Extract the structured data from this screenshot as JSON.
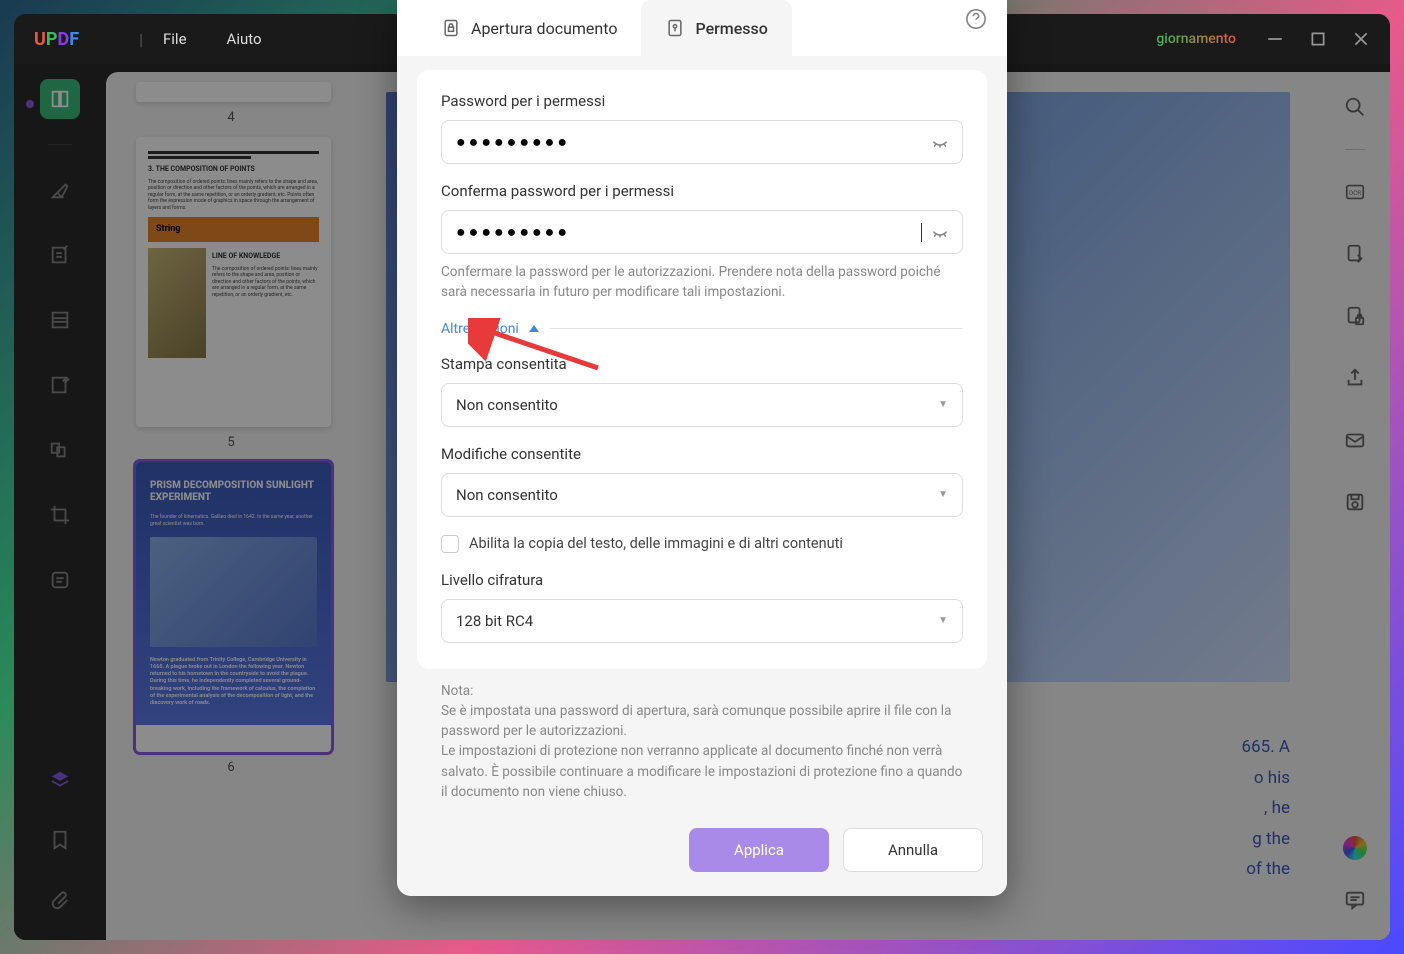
{
  "titlebar": {
    "logo_chars": [
      "U",
      "P",
      "D",
      "F"
    ],
    "menu_file": "File",
    "menu_help": "Aiuto",
    "update_text": "giornamento"
  },
  "thumbnails": {
    "page4_num": "4",
    "page5_num": "5",
    "page6_num": "6",
    "page5": {
      "heading": "3. THE COMPOSITION OF POINTS",
      "band": "String",
      "sub": "LINE OF KNOWLEDGE"
    },
    "page6": {
      "title": "PRISM DECOMPOSITION SUNLIGHT EXPERIMENT",
      "caption": "Newton graduated from Trinity College, Cambridge University in 1665. A plague broke out in London the following year. Newton returned to his hometown in the countryside to avoid the plague. During this time, he independently completed several ground-breaking work, including the framework of calculus, the completion of the experimental analysis of the decomposition of light, and the discovery work of roads."
    }
  },
  "main_doc": {
    "text_lines": [
      "665. A",
      "o his",
      ", he",
      "g the",
      "of the"
    ]
  },
  "dialog": {
    "tab_open": "Apertura documento",
    "tab_perm": "Permesso",
    "pwd_label": "Password per i permessi",
    "pwd_value": "●●●●●●●●●",
    "pwd2_label": "Conferma password per i permessi",
    "pwd2_value": "●●●●●●●●●",
    "pwd_help": "Confermare la password per le autorizzazioni. Prendere nota della password poiché sarà necessaria in futuro per modificare tali impostazioni.",
    "more_opts": "Altre opzioni",
    "print_label": "Stampa consentita",
    "print_value": "Non consentito",
    "changes_label": "Modifiche consentite",
    "changes_value": "Non consentito",
    "copy_label": "Abilita la copia del testo, delle immagini e di altri contenuti",
    "enc_label": "Livello cifratura",
    "enc_value": "128 bit RC4",
    "note_title": "Nota:",
    "note_body1": "Se è impostata una password di apertura, sarà comunque possibile aprire il file con la password per le autorizzazioni.",
    "note_body2": "Le impostazioni di protezione non verranno applicate al documento finché non verrà salvato. È possibile continuare a modificare le impostazioni di protezione fino a quando il documento non viene chiuso.",
    "btn_apply": "Applica",
    "btn_cancel": "Annulla"
  }
}
